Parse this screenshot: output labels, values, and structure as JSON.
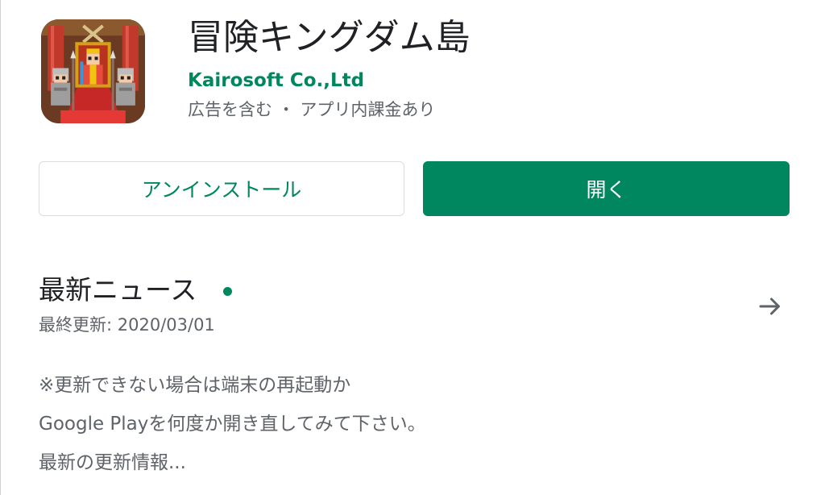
{
  "app": {
    "title": "冒険キングダム島",
    "developer": "Kairosoft Co.,Ltd",
    "meta": "広告を含む ・ アプリ内課金あり",
    "icon": "kingdom-throne-pixel-art"
  },
  "actions": {
    "uninstall_label": "アンインストール",
    "open_label": "開く"
  },
  "news": {
    "title": "最新ニュース",
    "last_updated": "最終更新: 2020/03/01",
    "arrow_icon": "arrow-right-icon",
    "lines": [
      "※更新できない場合は端末の再起動か",
      "Google Playを何度か開き直してみて下さい。",
      "最新の更新情報..."
    ]
  },
  "colors": {
    "accent": "#01875f",
    "text_primary": "#202124",
    "text_secondary": "#5f6368",
    "border": "#dadce0"
  }
}
